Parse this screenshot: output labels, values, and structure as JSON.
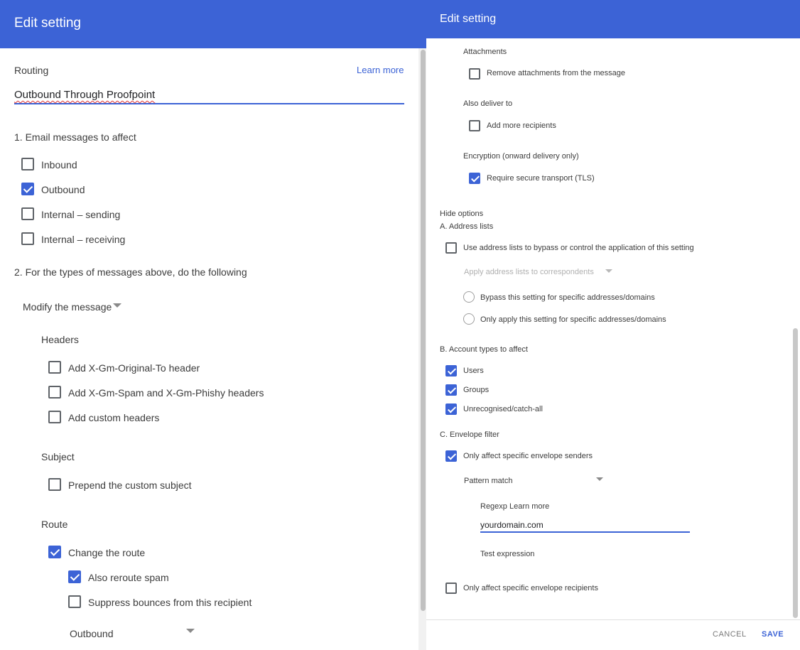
{
  "left": {
    "header_title": "Edit setting",
    "routing_label": "Routing",
    "learn_more": "Learn more",
    "setting_name": "Outbound Through Proofpoint",
    "section1_title": "1. Email messages to affect",
    "affect": {
      "inbound": "Inbound",
      "outbound": "Outbound",
      "internal_sending": "Internal – sending",
      "internal_receiving": "Internal – receiving"
    },
    "section2_title": "2. For the types of messages above, do the following",
    "action_select": "Modify the message",
    "headers_title": "Headers",
    "headers": {
      "original_to": "Add X-Gm-Original-To header",
      "spam_phishy": "Add X-Gm-Spam and X-Gm-Phishy headers",
      "custom": "Add custom headers"
    },
    "subject_title": "Subject",
    "subject": {
      "prepend": "Prepend the custom subject"
    },
    "route_title": "Route",
    "route": {
      "change_route": "Change the route",
      "reroute_spam": "Also reroute spam",
      "suppress_bounces": "Suppress bounces from this recipient"
    },
    "route_select": "Outbound"
  },
  "right": {
    "header_title": "Edit setting",
    "attachments_title": "Attachments",
    "remove_attachments": "Remove attachments from the message",
    "also_deliver_title": "Also deliver to",
    "add_recipients": "Add more recipients",
    "encryption_title": "Encryption (onward delivery only)",
    "require_tls": "Require secure transport (TLS)",
    "hide_options": "Hide options",
    "address_lists_title": "A. Address lists",
    "use_address_lists": "Use address lists to bypass or control the application of this setting",
    "apply_address_lists_select": "Apply address lists to correspondents",
    "bypass_option": "Bypass this setting for specific addresses/domains",
    "only_apply_option": "Only apply this setting for specific addresses/domains",
    "account_types_title": "B. Account types to affect",
    "users": "Users",
    "groups": "Groups",
    "unrecognised": "Unrecognised/catch-all",
    "envelope_filter_title": "C. Envelope filter",
    "only_senders": "Only affect specific envelope senders",
    "pattern_select": "Pattern match",
    "regexp_label": "Regexp",
    "regexp_learn_more": "Learn more",
    "regexp_value": "yourdomain.com",
    "test_expression": "Test expression",
    "only_recipients": "Only affect specific envelope recipients",
    "cancel": "CANCEL",
    "save": "SAVE"
  },
  "colors": {
    "header_blue": "#3c63d6",
    "link_blue": "#3c63d6",
    "checkbox_checked": "#3c63d6",
    "text": "#3c3c3c",
    "disabled_text": "#b0b0b0"
  },
  "icons": [
    "checkbox-checked-icon",
    "checkbox-unchecked-icon",
    "radio-unchecked-icon",
    "dropdown-caret-icon"
  ]
}
